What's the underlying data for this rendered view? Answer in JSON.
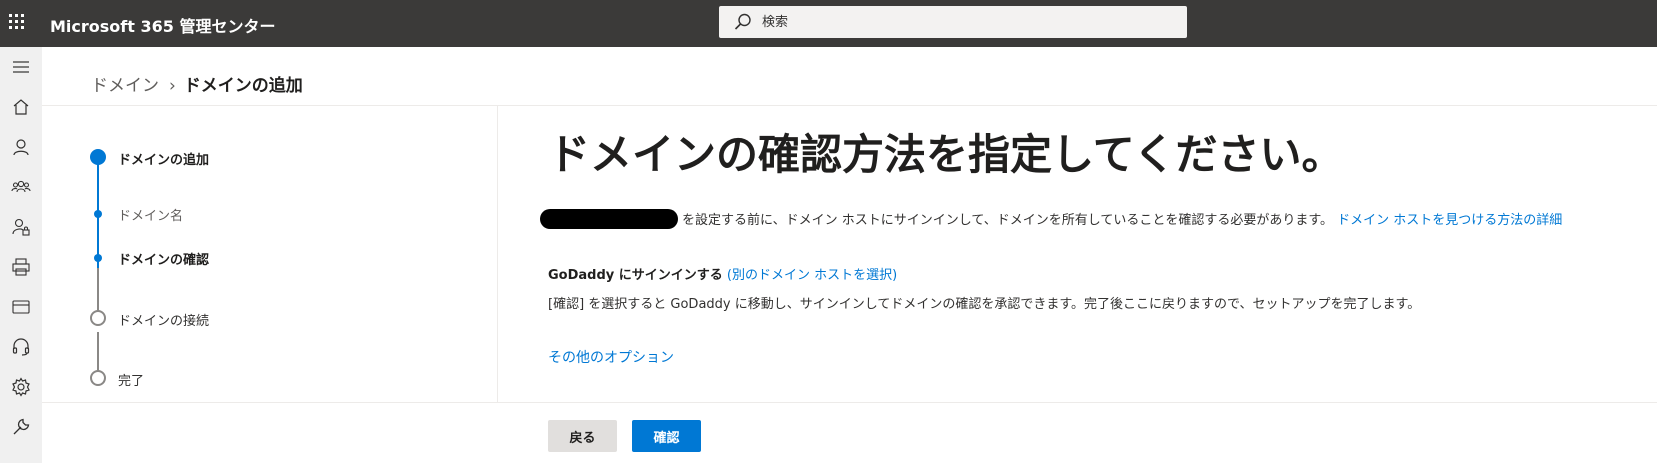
{
  "app": {
    "title": "Microsoft 365 管理センター"
  },
  "search": {
    "placeholder": "検索"
  },
  "nav": {
    "items": [
      {
        "icon": "hamburger-icon"
      },
      {
        "icon": "home-icon"
      },
      {
        "icon": "user-icon"
      },
      {
        "icon": "group-icon"
      },
      {
        "icon": "user-lock-icon"
      },
      {
        "icon": "printer-icon"
      },
      {
        "icon": "credit-card-icon"
      },
      {
        "icon": "headset-icon"
      },
      {
        "icon": "gear-icon"
      },
      {
        "icon": "wrench-icon"
      }
    ]
  },
  "breadcrumb": {
    "parent": "ドメイン",
    "separator": "›",
    "current": "ドメインの追加"
  },
  "stepper": {
    "steps": [
      {
        "label": "ドメインの追加",
        "state": "current-parent"
      },
      {
        "label": "ドメイン名",
        "state": "completed"
      },
      {
        "label": "ドメインの確認",
        "state": "current"
      },
      {
        "label": "ドメインの接続",
        "state": "pending"
      },
      {
        "label": "完了",
        "state": "pending"
      }
    ]
  },
  "main": {
    "title": "ドメインの確認方法を指定してください。",
    "description": "を設定する前に、ドメイン ホストにサインインして、ドメインを所有していることを確認する必要があります。",
    "description_link": "ドメイン ホストを見つける方法の詳細",
    "provider_text": "GoDaddy にサインインする",
    "provider_link": "(別のドメイン ホストを選択)",
    "info": "[確認] を選択すると GoDaddy に移動し、サインインしてドメインの確認を承認できます。完了後ここに戻りますので、セットアップを完了します。",
    "more_options": "その他のオプション"
  },
  "footer": {
    "back_label": "戻る",
    "confirm_label": "確認"
  },
  "colors": {
    "accent": "#0078d4",
    "topbar": "#3b3a39",
    "nav_bg": "#f0f0f0"
  }
}
